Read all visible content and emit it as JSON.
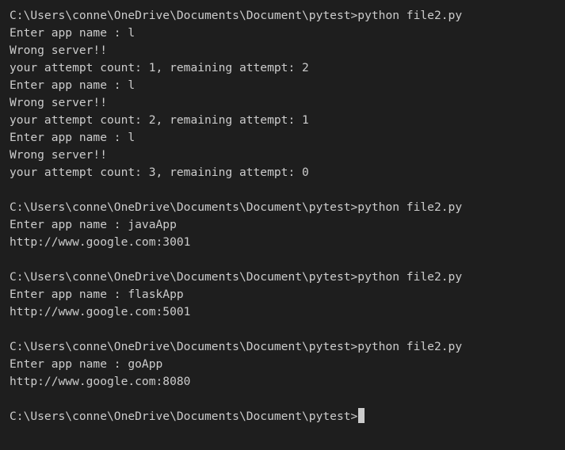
{
  "terminal": {
    "lines": [
      "C:\\Users\\conne\\OneDrive\\Documents\\Document\\pytest>python file2.py",
      "Enter app name : l",
      "Wrong server!!",
      "your attempt count: 1, remaining attempt: 2",
      "Enter app name : l",
      "Wrong server!!",
      "your attempt count: 2, remaining attempt: 1",
      "Enter app name : l",
      "Wrong server!!",
      "your attempt count: 3, remaining attempt: 0",
      "",
      "C:\\Users\\conne\\OneDrive\\Documents\\Document\\pytest>python file2.py",
      "Enter app name : javaApp",
      "http://www.google.com:3001",
      "",
      "C:\\Users\\conne\\OneDrive\\Documents\\Document\\pytest>python file2.py",
      "Enter app name : flaskApp",
      "http://www.google.com:5001",
      "",
      "C:\\Users\\conne\\OneDrive\\Documents\\Document\\pytest>python file2.py",
      "Enter app name : goApp",
      "http://www.google.com:8080",
      "",
      "C:\\Users\\conne\\OneDrive\\Documents\\Document\\pytest>"
    ],
    "colors": {
      "background": "#1e1e1e",
      "text": "#cccccc"
    }
  }
}
